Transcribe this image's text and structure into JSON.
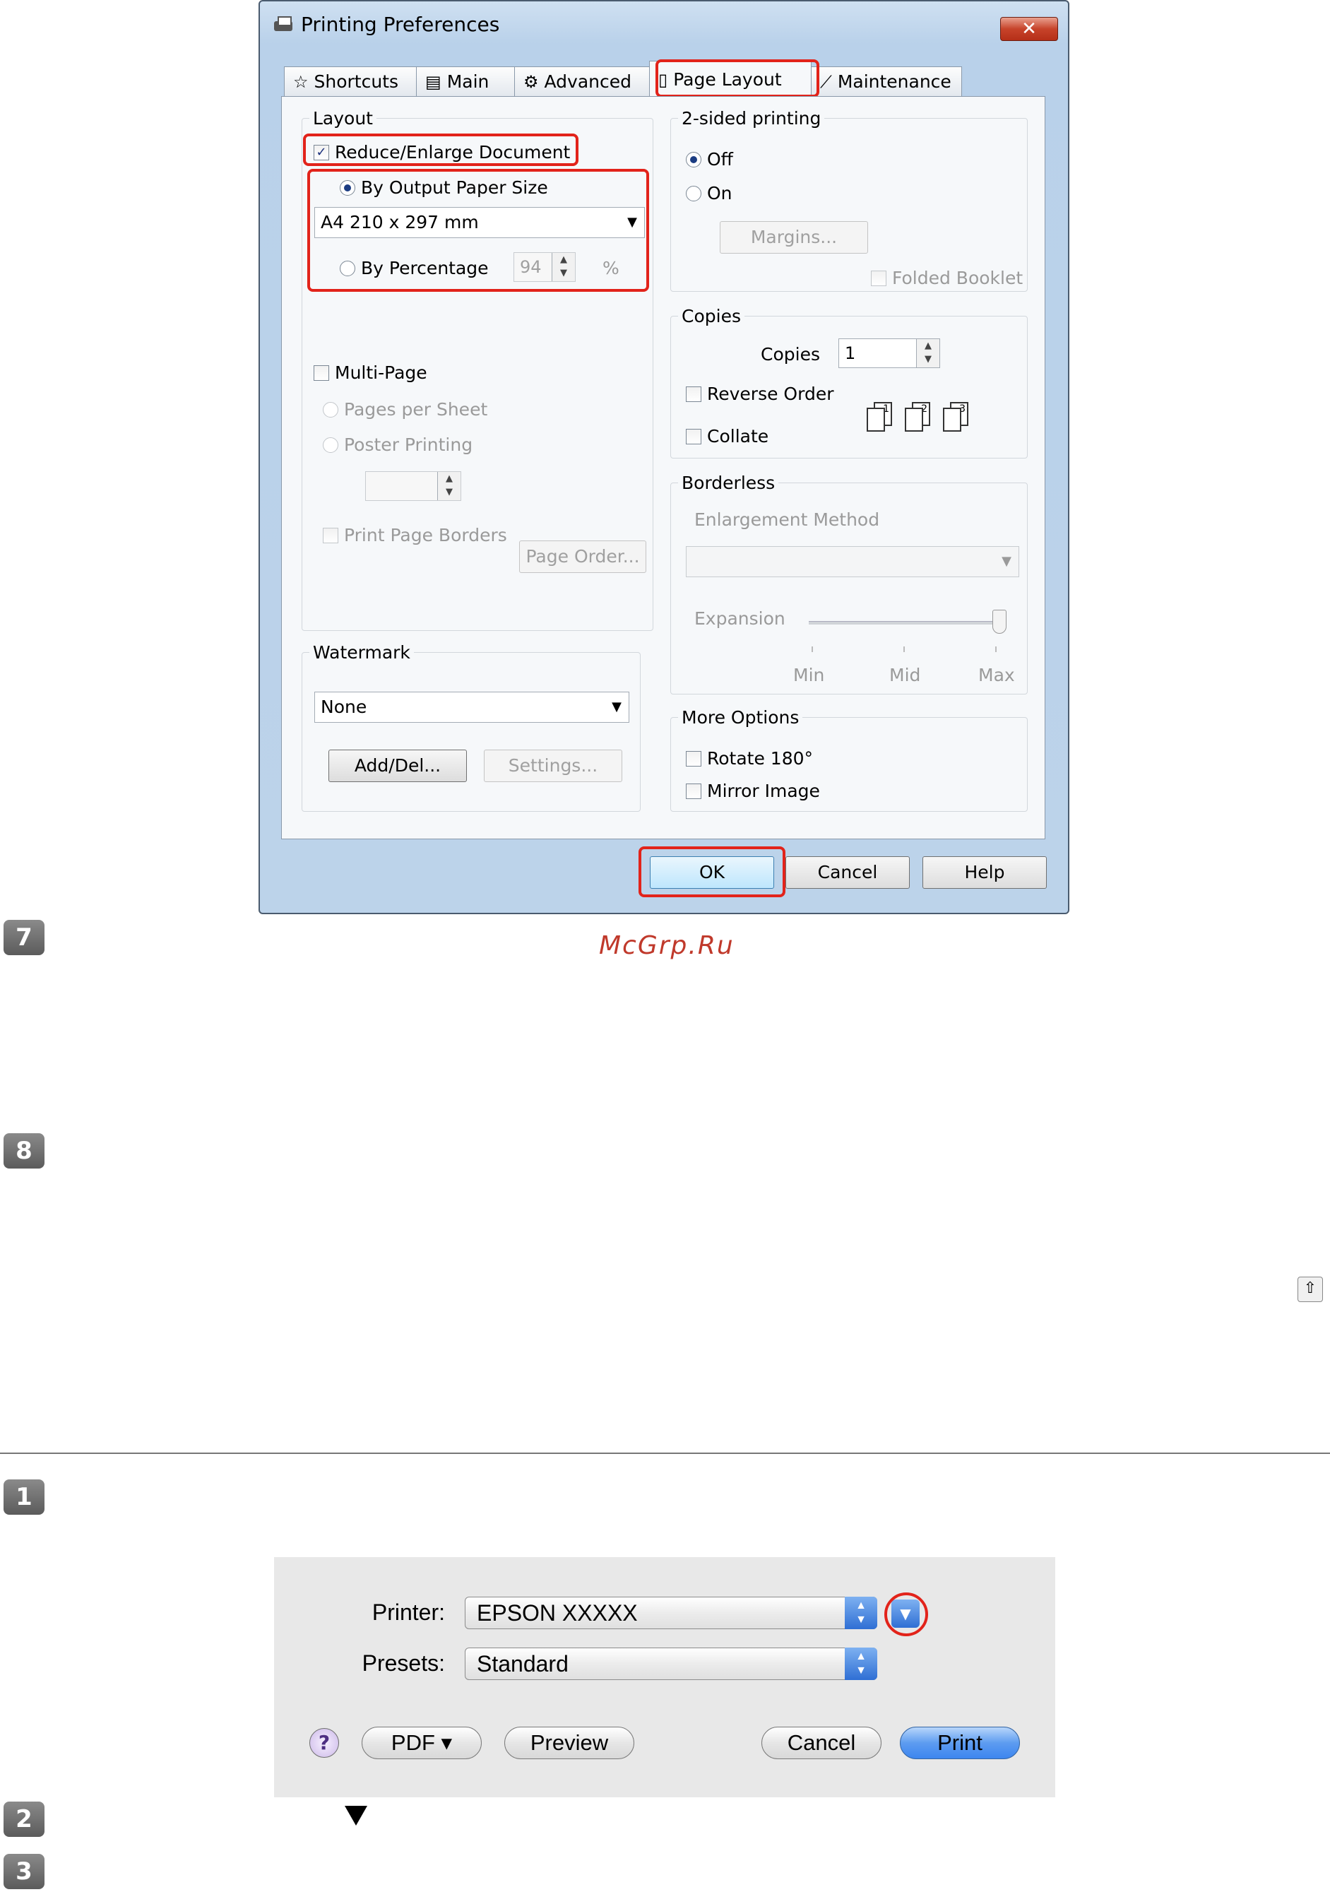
{
  "dialog": {
    "title": "Printing Preferences",
    "close_label": "✕",
    "tabs": [
      {
        "label": "Shortcuts",
        "icon": "star-icon"
      },
      {
        "label": "Main",
        "icon": "printer-icon"
      },
      {
        "label": "Advanced",
        "icon": "gears-icon"
      },
      {
        "label": "Page Layout",
        "icon": "page-icon"
      },
      {
        "label": "Maintenance",
        "icon": "wrench-icon"
      }
    ],
    "layout": {
      "legend": "Layout",
      "reduce_enlarge": "Reduce/Enlarge Document",
      "by_output_paper_size": "By Output Paper Size",
      "paper_size": "A4 210 x 297 mm",
      "by_percentage": "By Percentage",
      "percentage_value": "94",
      "percent_sign": "%",
      "multi_page": "Multi-Page",
      "pages_per_sheet": "Pages per Sheet",
      "poster_printing": "Poster Printing",
      "print_page_borders": "Print Page Borders",
      "page_order": "Page Order..."
    },
    "two_sided": {
      "legend": "2-sided printing",
      "off": "Off",
      "on": "On",
      "margins": "Margins...",
      "folded_booklet": "Folded Booklet"
    },
    "copies": {
      "legend": "Copies",
      "label": "Copies",
      "value": "1",
      "reverse_order": "Reverse Order",
      "collate": "Collate",
      "collate_pages": [
        "1",
        "2",
        "3"
      ]
    },
    "borderless": {
      "legend": "Borderless",
      "enlargement_method": "Enlargement Method",
      "expansion": "Expansion",
      "min": "Min",
      "mid": "Mid",
      "max": "Max",
      "expansion_level": 1.0
    },
    "watermark": {
      "legend": "Watermark",
      "value": "None",
      "add_del": "Add/Del...",
      "settings": "Settings..."
    },
    "more_options": {
      "legend": "More Options",
      "rotate": "Rotate 180°",
      "mirror": "Mirror Image"
    },
    "buttons": {
      "ok": "OK",
      "cancel": "Cancel",
      "help": "Help"
    }
  },
  "steps": {
    "s7": "7",
    "s8": "8",
    "s1": "1",
    "s2": "2",
    "s3": "3"
  },
  "watermark_text": "McGrp.Ru",
  "back_to_top_icon": "⇧",
  "mac_panel": {
    "printer_label": "Printer:",
    "printer_value": "EPSON XXXXX",
    "presets_label": "Presets:",
    "presets_value": "Standard",
    "help": "?",
    "pdf": "PDF ▾",
    "preview": "Preview",
    "cancel": "Cancel",
    "print": "Print"
  },
  "colors": {
    "highlight": "#e2231a",
    "mac_default_button": "#3d86ef"
  }
}
